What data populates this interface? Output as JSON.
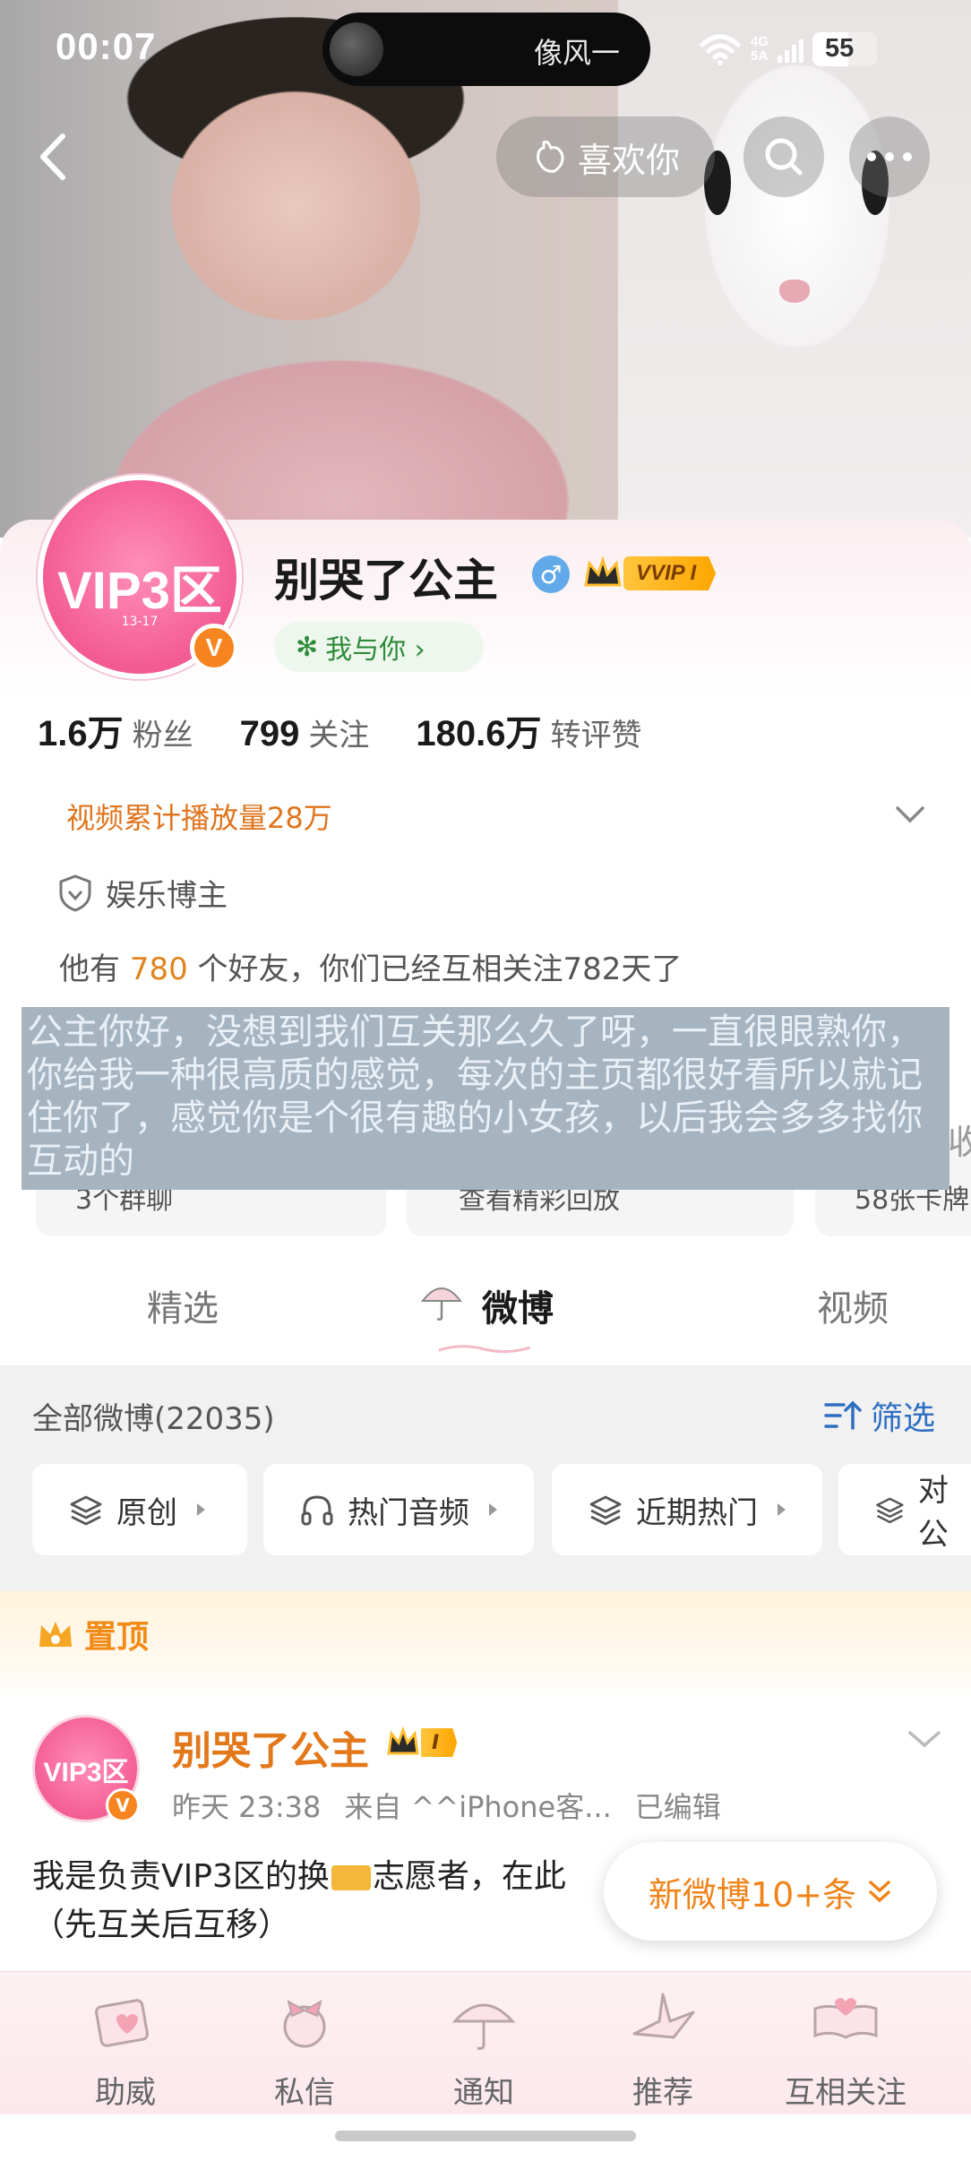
{
  "status_bar": {
    "time": "00:07",
    "island_text": "像风一",
    "net_top": "4G",
    "net_bottom": "5A",
    "battery": "55"
  },
  "header": {
    "like_label": "喜欢你"
  },
  "profile": {
    "avatar_text": "VIP3区",
    "avatar_subtext": "13-17",
    "verified_badge": "V",
    "name": "别哭了公主",
    "gender_symbol": "♂",
    "vip_label": "VVIP I",
    "relation_label": "我与你 ›",
    "stats": [
      {
        "value": "1.6万",
        "label": "粉丝"
      },
      {
        "value": "799",
        "label": "关注"
      },
      {
        "value": "180.6万",
        "label": "转评赞"
      }
    ],
    "views_text": "视频累计播放量28万",
    "category": "娱乐博主",
    "friends_prefix": "他有 ",
    "friends_count": "780",
    "friends_suffix": " 个好友，你们已经互相关注782天了"
  },
  "message_overlay": {
    "text": "公主你好，没想到我们互关那么久了呀，一直很眼熟你，你给我一种很高质的感觉，每次的主页都很好看所以就记住你了，感觉你是个很有趣的小女孩，以后我会多多找你互动的",
    "edge_char": "收"
  },
  "chips": [
    {
      "label": "3个群聊"
    },
    {
      "label": "查看精彩回放"
    },
    {
      "label": "58张卡牌"
    }
  ],
  "tabs": [
    {
      "label": "精选"
    },
    {
      "label": "微博"
    },
    {
      "label": "视频"
    }
  ],
  "feed": {
    "title": "全部微博(22035)",
    "filter_label": "筛选",
    "pills": [
      {
        "label": "原创"
      },
      {
        "label": "热门音频"
      },
      {
        "label": "近期热门"
      },
      {
        "label": "对公"
      }
    ]
  },
  "pinned": {
    "label": "置顶"
  },
  "post": {
    "avatar_text": "VIP3区",
    "author": "别哭了公主",
    "badge": "I",
    "time": "昨天 23:38",
    "source": "来自 ^^iPhone客...",
    "edited": "已编辑",
    "text_part1": "我是负责VIP3区的换",
    "text_part2": "志愿者，在此",
    "text_line2": "（先互关后互移）"
  },
  "new_posts": {
    "label": "新微博10+条"
  },
  "bottom_nav": [
    {
      "label": "助威"
    },
    {
      "label": "私信"
    },
    {
      "label": "通知"
    },
    {
      "label": "推荐"
    },
    {
      "label": "互相关注"
    }
  ],
  "colors": {
    "accent_orange": "#e3781a",
    "link_blue": "#2f6fc2",
    "overlay_bg": "#a6b4c0",
    "avatar_pink": "#f35b92"
  }
}
